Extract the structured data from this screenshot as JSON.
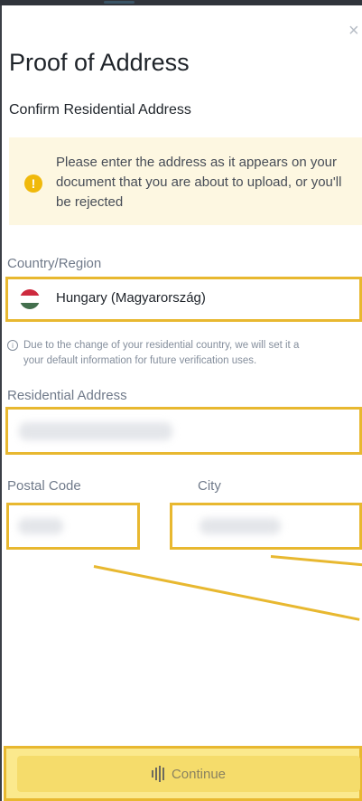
{
  "window": {
    "close_glyph": "×"
  },
  "page": {
    "title": "Proof of Address",
    "subtitle": "Confirm Residential Address"
  },
  "notice": {
    "icon": "warning-icon",
    "icon_glyph": "!",
    "text": "Please enter the address as it appears on your document that you are about to upload, or you'll be rejected",
    "background": "#fdf7e1",
    "icon_color": "#f0b90b"
  },
  "country": {
    "label": "Country/Region",
    "value": "Hungary (Magyarország)",
    "flag_icon": "hungary-flag-icon",
    "flag_colors": [
      "#cd2a3e",
      "#ffffff",
      "#436f4d"
    ]
  },
  "info": {
    "icon": "info-icon",
    "icon_glyph": "i",
    "line1": "Due to the change of your residential country, we will set it a",
    "line2": "your default information for future verification uses."
  },
  "residential_address": {
    "label": "Residential Address"
  },
  "postal_code": {
    "label": "Postal Code"
  },
  "city": {
    "label": "City"
  },
  "continue_button": {
    "label": "Continue",
    "icon": "loading-bars-icon"
  },
  "colors": {
    "highlight": "#e8b830",
    "accent": "#f0b90b"
  }
}
